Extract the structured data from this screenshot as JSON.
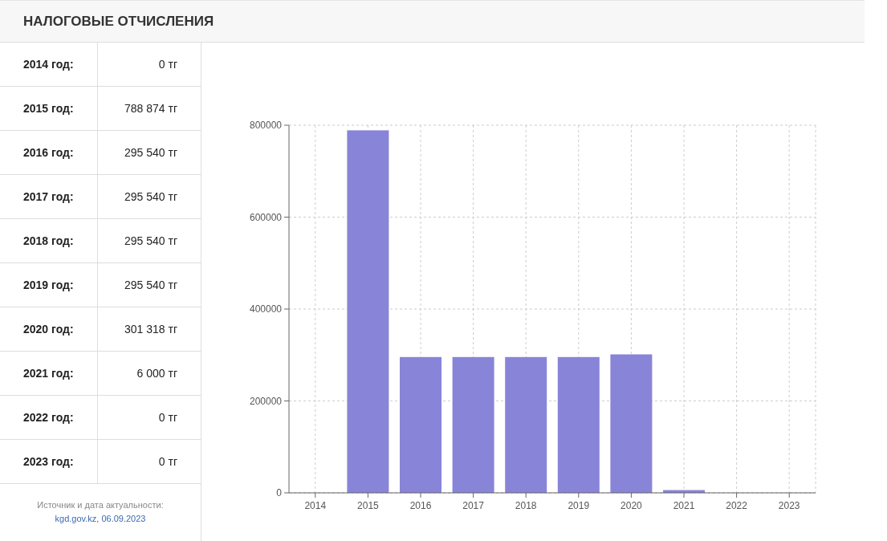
{
  "title": "НАЛОГОВЫЕ ОТЧИСЛЕНИЯ",
  "rows": [
    {
      "label": "2014 год:",
      "value": "0 тг"
    },
    {
      "label": "2015 год:",
      "value": "788 874 тг"
    },
    {
      "label": "2016 год:",
      "value": "295 540 тг"
    },
    {
      "label": "2017 год:",
      "value": "295 540 тг"
    },
    {
      "label": "2018 год:",
      "value": "295 540 тг"
    },
    {
      "label": "2019 год:",
      "value": "295 540 тг"
    },
    {
      "label": "2020 год:",
      "value": "301 318 тг"
    },
    {
      "label": "2021 год:",
      "value": "6 000 тг"
    },
    {
      "label": "2022 год:",
      "value": "0 тг"
    },
    {
      "label": "2023 год:",
      "value": "0 тг"
    }
  ],
  "source": {
    "label": "Источник и дата актуальности:",
    "link": "kgd.gov.kz, 06.09.2023"
  },
  "chart_data": {
    "type": "bar",
    "categories": [
      "2014",
      "2015",
      "2016",
      "2017",
      "2018",
      "2019",
      "2020",
      "2021",
      "2022",
      "2023"
    ],
    "values": [
      0,
      788874,
      295540,
      295540,
      295540,
      295540,
      301318,
      6000,
      0,
      0
    ],
    "ylim": [
      0,
      800000
    ],
    "grid": true,
    "yticks": [
      0,
      200000,
      400000,
      600000,
      800000
    ]
  }
}
